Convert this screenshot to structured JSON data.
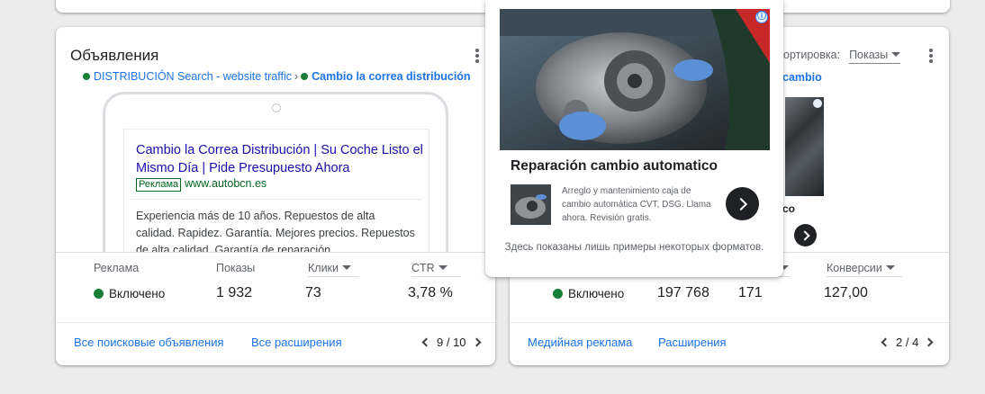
{
  "ads_card": {
    "title": "Объявления",
    "breadcrumb": {
      "campaign": "DISTRIBUCIÓN Search - website traffic",
      "separator": "›",
      "ad_group": "Cambio la correa distribución"
    },
    "ad_preview": {
      "headline": "Cambio la Correa Distribución | Su Coche Listo el Mismo Día | Pide Presupuesto Ahora",
      "badge": "Реклама",
      "display_url": "www.autobcn.es",
      "description": "Experiencia más de 10 años. Repuestos de alta calidad. Rapidez. Garantía. Mejores precios. Repuestos de alta calidad. Garantía de reparación."
    },
    "stats": {
      "headers": {
        "ad": "Реклама",
        "impressions": "Показы",
        "clicks": "Клики",
        "ctr": "CTR"
      },
      "values": {
        "status": "Включено",
        "impressions": "1 932",
        "clicks": "73",
        "ctr": "3,78 %"
      }
    },
    "footer": {
      "link_all_ads": "Все поисковые объявления",
      "link_extensions": "Все расширения",
      "pager": "9 / 10"
    }
  },
  "display_card": {
    "sort_label": "ортировка:",
    "sort_value": "Показы",
    "breadcrumb_tail": "cambio",
    "truncated_text": "co",
    "stats": {
      "headers": {
        "conversions": "Конверсии"
      },
      "values": {
        "status": "Включено",
        "impressions": "197 768",
        "clicks": "171",
        "conversions": "127,00"
      }
    },
    "footer": {
      "link_display": "Медийная реклама",
      "link_extensions": "Расширения",
      "pager": "2 / 4"
    }
  },
  "ad_popup": {
    "info_glyph": "ⓘ",
    "title": "Reparación cambio automatico",
    "description": "Arreglo y mantenimiento caja de cambio automática CVT, DSG. Llama ahora. Revisión gratis.",
    "note": "Здесь показаны лишь примеры некоторых форматов."
  },
  "colors": {
    "link_blue": "#1a73e8",
    "headline_blue": "#1a0dab",
    "status_green": "#188038",
    "url_green": "#006621"
  }
}
